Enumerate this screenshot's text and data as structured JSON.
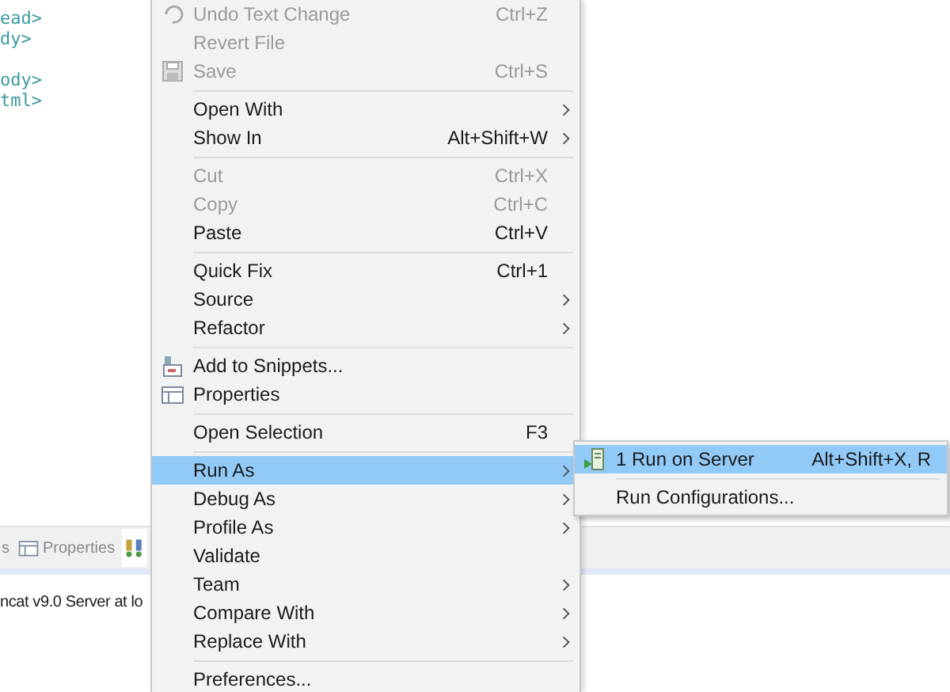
{
  "editor": {
    "lines": [
      {
        "text": "ead>"
      },
      {
        "text": "dy>"
      },
      {
        "text": "ody>"
      },
      {
        "text": "tml>"
      }
    ]
  },
  "panel": {
    "tabs": [
      {
        "label": "s",
        "selected": false
      },
      {
        "label": "Properties",
        "selected": false
      },
      {
        "selected": true
      }
    ],
    "content": "ncat v9.0 Server at lo"
  },
  "context_menu": {
    "groups": [
      [
        {
          "label": "Undo Text Change",
          "shortcut": "Ctrl+Z",
          "disabled": true,
          "submenu": false,
          "selected": false
        },
        {
          "label": "Revert File",
          "disabled": true,
          "submenu": false,
          "selected": false
        },
        {
          "label": "Save",
          "shortcut": "Ctrl+S",
          "disabled": true,
          "submenu": false,
          "selected": false
        }
      ],
      [
        {
          "label": "Open With",
          "disabled": false,
          "submenu": true,
          "selected": false
        },
        {
          "label": "Show In",
          "shortcut": "Alt+Shift+W",
          "disabled": false,
          "submenu": true,
          "selected": false
        }
      ],
      [
        {
          "label": "Cut",
          "shortcut": "Ctrl+X",
          "disabled": true,
          "submenu": false,
          "selected": false
        },
        {
          "label": "Copy",
          "shortcut": "Ctrl+C",
          "disabled": true,
          "submenu": false,
          "selected": false
        },
        {
          "label": "Paste",
          "shortcut": "Ctrl+V",
          "disabled": false,
          "submenu": false,
          "selected": false
        }
      ],
      [
        {
          "label": "Quick Fix",
          "shortcut": "Ctrl+1",
          "disabled": false,
          "submenu": false,
          "selected": false
        },
        {
          "label": "Source",
          "disabled": false,
          "submenu": true,
          "selected": false
        },
        {
          "label": "Refactor",
          "disabled": false,
          "submenu": true,
          "selected": false
        }
      ],
      [
        {
          "label": "Add to Snippets...",
          "disabled": false,
          "submenu": false,
          "selected": false
        },
        {
          "label": "Properties",
          "disabled": false,
          "submenu": false,
          "selected": false
        }
      ],
      [
        {
          "label": "Open Selection",
          "shortcut": "F3",
          "disabled": false,
          "submenu": false,
          "selected": false
        }
      ],
      [
        {
          "label": "Run As",
          "disabled": false,
          "submenu": true,
          "selected": true
        },
        {
          "label": "Debug As",
          "disabled": false,
          "submenu": true,
          "selected": false
        },
        {
          "label": "Profile As",
          "disabled": false,
          "submenu": true,
          "selected": false
        },
        {
          "label": "Validate",
          "disabled": false,
          "submenu": false,
          "selected": false
        },
        {
          "label": "Team",
          "disabled": false,
          "submenu": true,
          "selected": false
        },
        {
          "label": "Compare With",
          "disabled": false,
          "submenu": true,
          "selected": false
        },
        {
          "label": "Replace With",
          "disabled": false,
          "submenu": true,
          "selected": false
        }
      ],
      [
        {
          "label": "Preferences...",
          "disabled": false,
          "submenu": false,
          "selected": false
        }
      ]
    ]
  },
  "submenu": {
    "groups": [
      [
        {
          "label": "1 Run on Server",
          "shortcut": "Alt+Shift+X, R",
          "selected": true
        }
      ],
      [
        {
          "label": "Run Configurations...",
          "selected": false
        }
      ]
    ]
  }
}
